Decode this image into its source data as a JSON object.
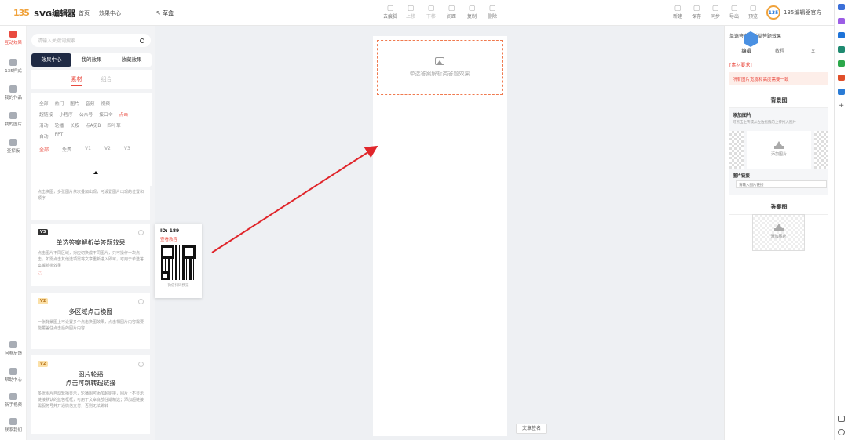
{
  "header": {
    "logo_mark": "135",
    "logo_text": "SVG编辑器",
    "nav": [
      "首页",
      "效果中心"
    ],
    "draft": "草盒",
    "tools": [
      {
        "label": "去痕脚",
        "icon": "grid-icon",
        "dim": false
      },
      {
        "label": "上移",
        "icon": "up-icon",
        "dim": true
      },
      {
        "label": "下移",
        "icon": "down-icon",
        "dim": true
      },
      {
        "label": "间距",
        "icon": "spacing-icon",
        "dim": false
      },
      {
        "label": "复制",
        "icon": "copy-icon",
        "dim": false
      },
      {
        "label": "删除",
        "icon": "trash-icon",
        "dim": false
      }
    ],
    "right_tools": [
      "新建",
      "保存",
      "同步",
      "导出",
      "预览"
    ],
    "user_name": "135编辑器官方"
  },
  "leftnav": {
    "items": [
      "互动效果",
      "135样式",
      "我的作品",
      "我的图片",
      "查探板"
    ],
    "bottom": [
      "问卷反馈",
      "帮助中心",
      "新手视频",
      "联系我们"
    ]
  },
  "panel": {
    "search_placeholder": "请输入关键词搜索",
    "tabs": [
      "效果中心",
      "我的效果",
      "收藏效果"
    ],
    "subtabs": [
      "素材",
      "组合"
    ],
    "tag_rows": [
      [
        "全部",
        "热门",
        "图片",
        "音频",
        "视频"
      ],
      [
        "超链接",
        "小程序",
        "公众号",
        "接口令",
        "点击"
      ],
      [
        "滑动",
        "轮播",
        "长按",
        "点A见B",
        "四叶草"
      ],
      [
        "自动",
        "PPT"
      ]
    ],
    "version_tags": [
      "全部",
      "免费",
      "V1",
      "V2",
      "V3"
    ],
    "cards": [
      {
        "badge": "",
        "title": "",
        "desc": "点击换图，多张图片依次叠加出现，可设置图片出现的位置和顺序"
      },
      {
        "badge": "V3",
        "title": "单选答案解析类答题效果",
        "desc": "点击图片不同区域，对应切换成不同图片，只可操作一次点击，如需点击其他选项需将文章重新进入即可，可用于单选答案解析类效果"
      },
      {
        "badge": "V2",
        "title": "多区域点击换图",
        "desc": "一张背景图上可设置多个点击换图效果，点击相图片内容需要能覆盖住点击后的图片内容"
      },
      {
        "badge": "V2",
        "title": "图片轮播\n点击可跳转超链接",
        "desc": "多张图片自动轮播显示，轮播图可添加超链接，图片上不显示链接默认的蓝色框框，可用于文章底部往期精选；添加超链接需服务号并开通微信支付，否则无法跳转"
      }
    ]
  },
  "popup": {
    "id": "ID: 189",
    "link": "查看教程",
    "caption": "微信扫码预览"
  },
  "canvas": {
    "placeholder": "单选答案解析类答题效果",
    "signature_button": "文章签名"
  },
  "rpanel": {
    "title": "单选答案解析类答题效果",
    "tabs": [
      "编辑",
      "教程",
      "文"
    ],
    "requirement": "[素材要求]",
    "note": "所有图片宽度和高度需要一致",
    "bg_section": "背景图",
    "add_image": "添加图片",
    "add_image_sub": "可点击上传或从左边拖拽的上传拖入图片",
    "upload_label": "添加图片",
    "link_label": "图片链接",
    "link_placeholder": "请输入图片链接",
    "ans_section": "答案图",
    "ans_upload": "添加图片"
  }
}
